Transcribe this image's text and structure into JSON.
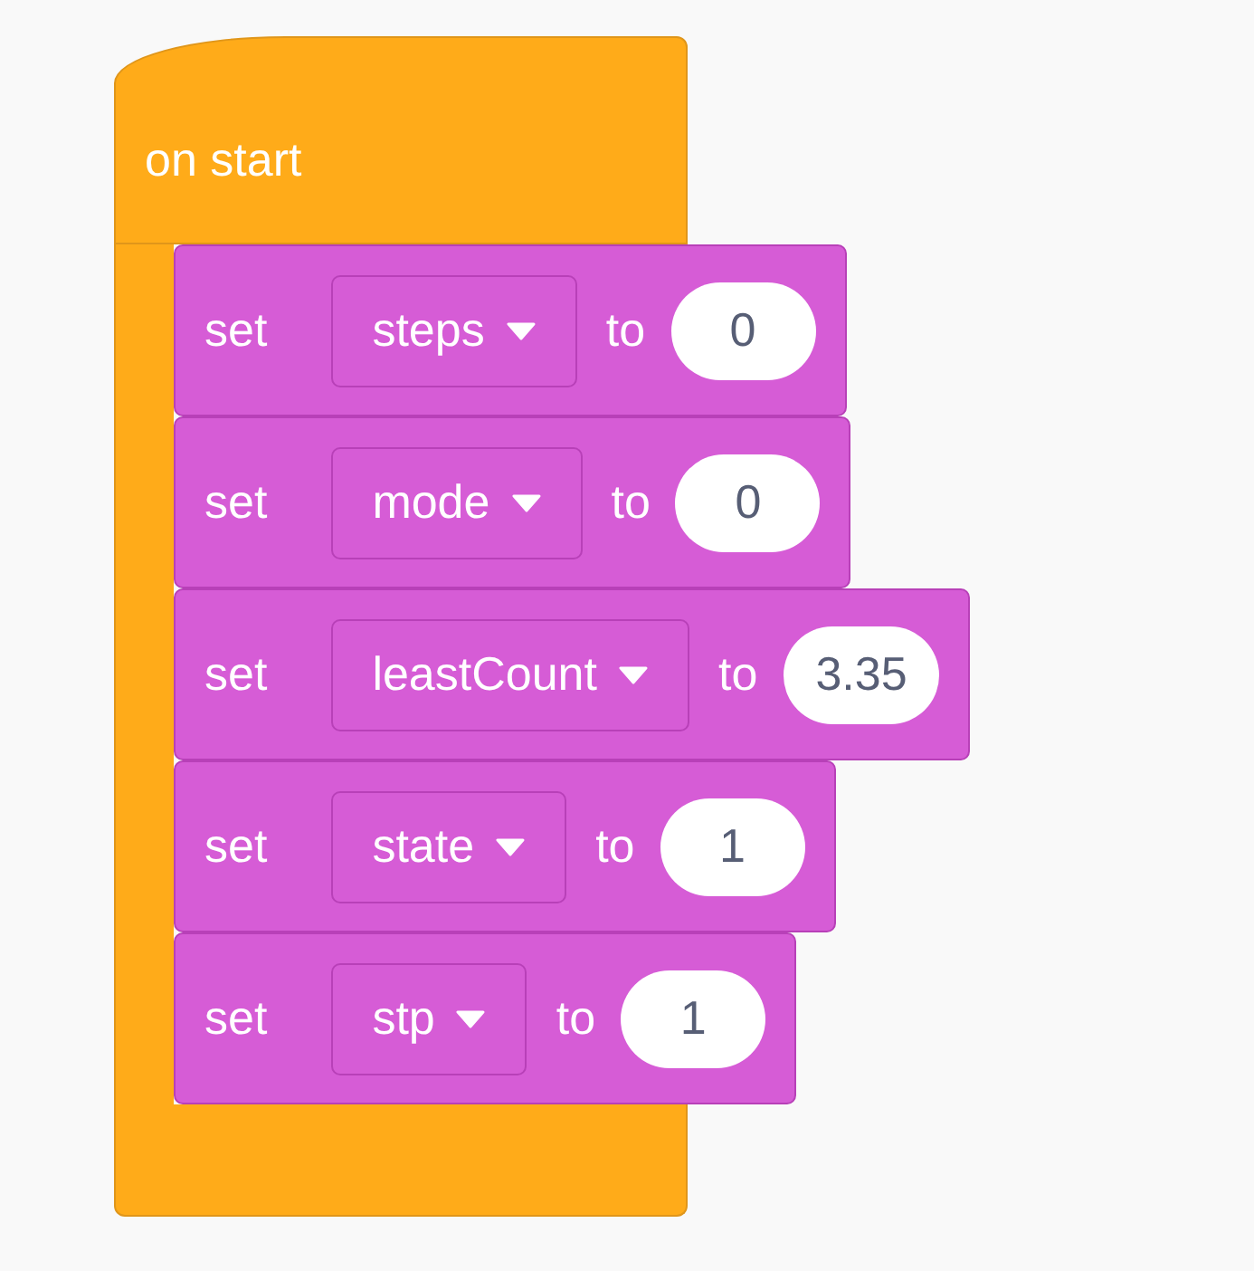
{
  "hat": {
    "label": "on start"
  },
  "blocks": [
    {
      "keyword": "set",
      "variable": "steps",
      "connector": "to",
      "value": "0"
    },
    {
      "keyword": "set",
      "variable": "mode",
      "connector": "to",
      "value": "0"
    },
    {
      "keyword": "set",
      "variable": "leastCount",
      "connector": "to",
      "value": "3.35"
    },
    {
      "keyword": "set",
      "variable": "state",
      "connector": "to",
      "value": "1"
    },
    {
      "keyword": "set",
      "variable": "stp",
      "connector": "to",
      "value": "1"
    }
  ]
}
